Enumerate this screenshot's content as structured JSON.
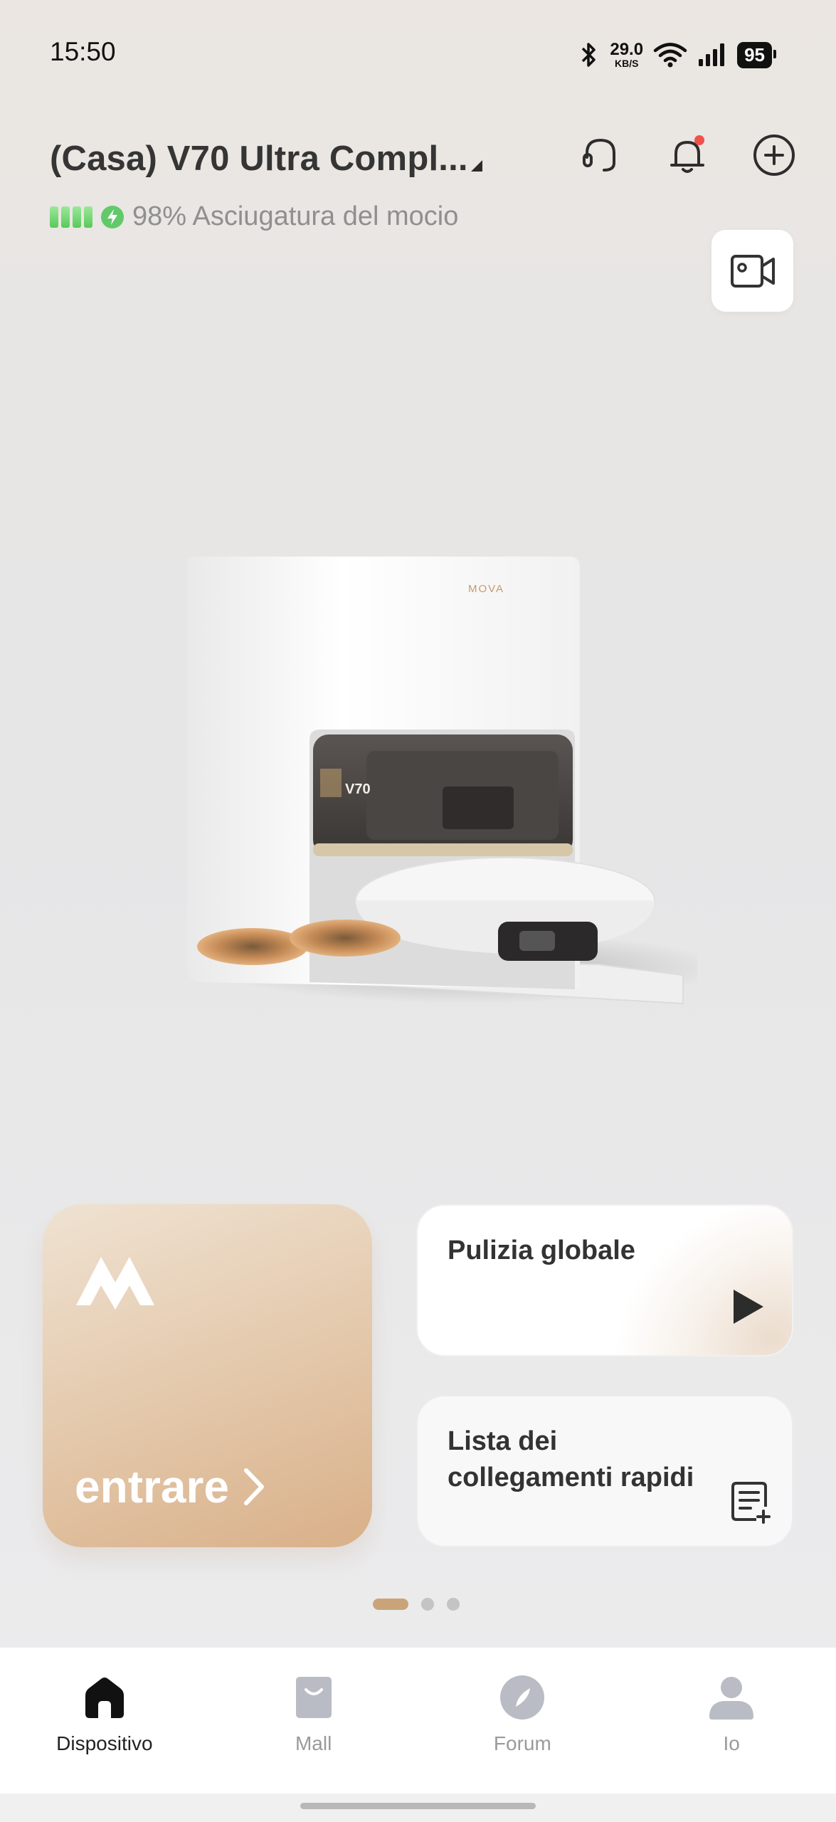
{
  "status_bar": {
    "time": "15:50",
    "network_speed_value": "29.0",
    "network_speed_unit": "KB/S",
    "battery_level": "95",
    "icons": [
      "bluetooth-icon",
      "wifi-icon",
      "signal-icon",
      "battery-icon"
    ]
  },
  "header": {
    "device_title": "(Casa) V70 Ultra Compl...",
    "status_text": "98% Asciugatura del mocio",
    "battery_percent": 98,
    "actions": [
      "support-headset-icon",
      "notification-bell-icon",
      "add-device-icon"
    ],
    "notification_badge": true
  },
  "video_button": {
    "icon": "video-camera-icon"
  },
  "product_image": {
    "brand_mark": "MOVA",
    "model_badge": "V70"
  },
  "cards": {
    "enter": {
      "label": "entrare",
      "logo": "mova-logo"
    },
    "global_clean": {
      "title": "Pulizia globale",
      "icon": "play-icon"
    },
    "quick_links": {
      "title_line1": "Lista dei",
      "title_line2": "collegamenti rapidi",
      "icon": "list-add-icon"
    }
  },
  "pager": {
    "total": 3,
    "active_index": 0
  },
  "bottom_nav": {
    "items": [
      {
        "label": "Dispositivo",
        "icon": "home-icon"
      },
      {
        "label": "Mall",
        "icon": "shopping-bag-icon"
      },
      {
        "label": "Forum",
        "icon": "compass-icon"
      },
      {
        "label": "Io",
        "icon": "profile-icon"
      }
    ],
    "active_index": 0
  },
  "colors": {
    "accent": "#c9a47a",
    "card_gradient_end": "#d9b089",
    "notification": "#f0524a",
    "battery_green": "#62c96a"
  }
}
